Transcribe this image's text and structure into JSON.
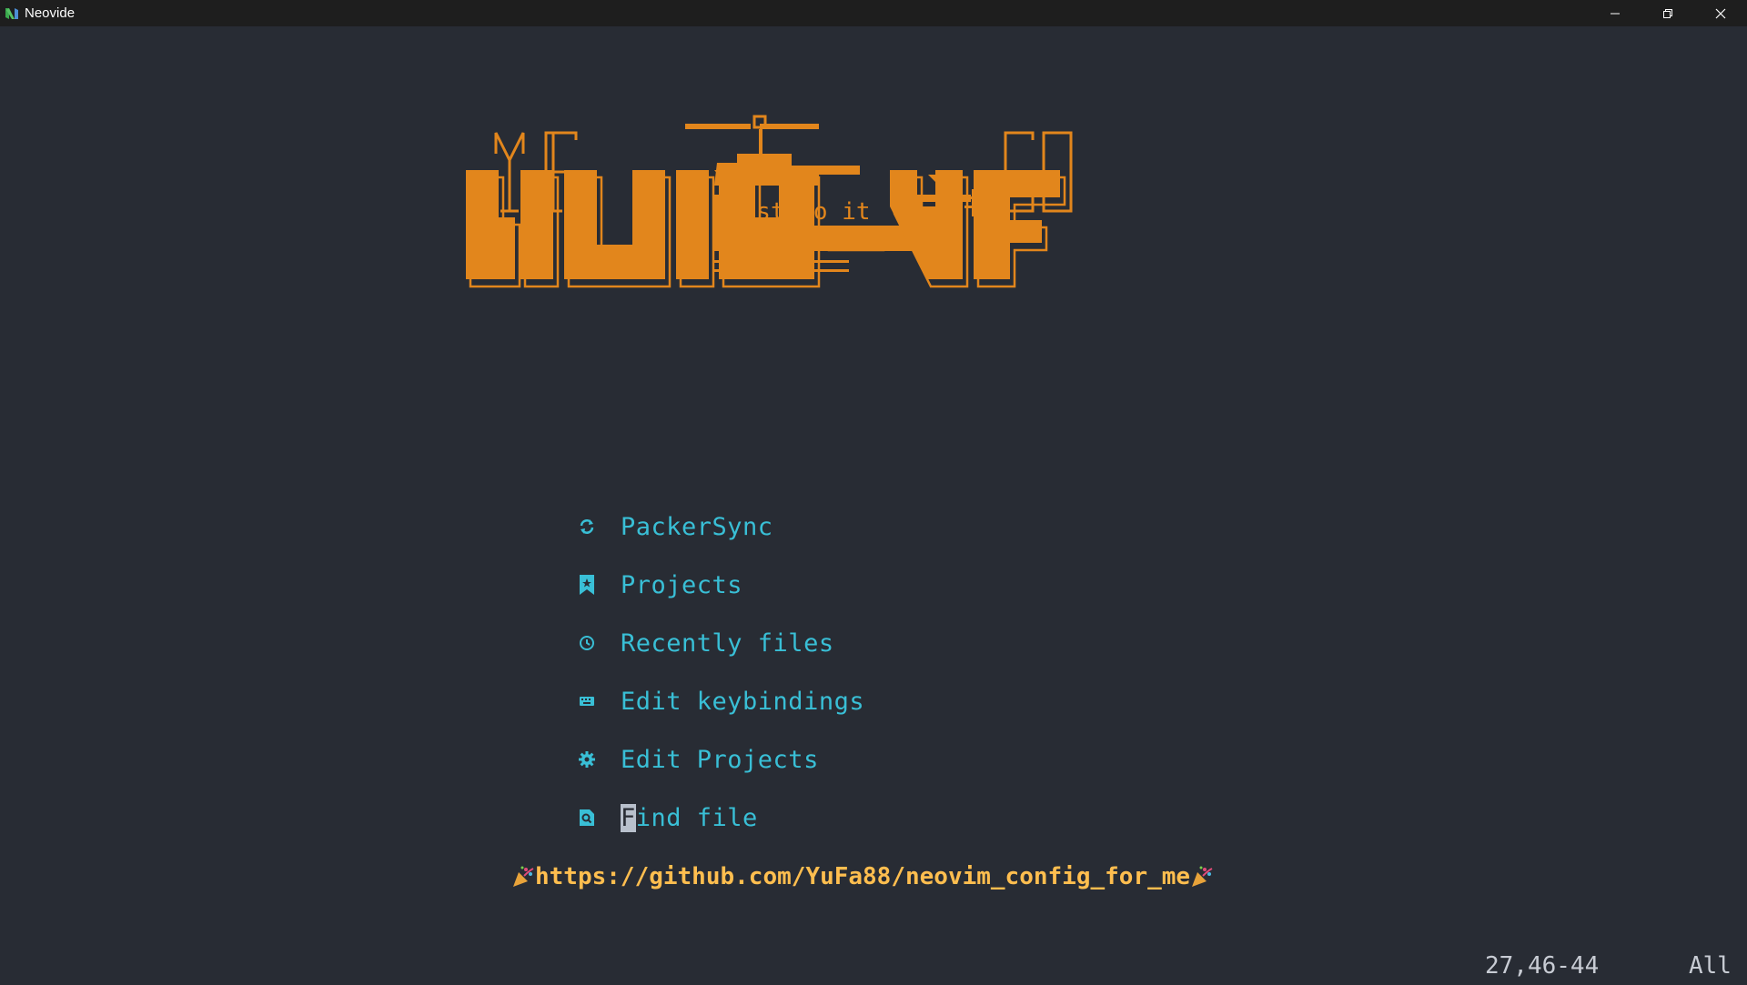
{
  "window": {
    "title": "Neovide",
    "controls": [
      "minimize",
      "restore",
      "close"
    ]
  },
  "colors": {
    "background": "#282c34",
    "banner_orange": "#e2861c",
    "menu_cyan": "#39bfd6",
    "footer_yellow": "#ffbe4f",
    "titlebar": "#1e1e1e"
  },
  "banner": {
    "left_tag": "YF",
    "right_tag": "GO",
    "helicopter_text": "just do it",
    "logo_text": "NVIM-YF"
  },
  "menu": {
    "items": [
      {
        "icon": "refresh-icon",
        "label": "PackerSync"
      },
      {
        "icon": "bookmark-icon",
        "label": "Projects"
      },
      {
        "icon": "history-icon",
        "label": "Recently files"
      },
      {
        "icon": "keyboard-icon",
        "label": "Edit keybindings"
      },
      {
        "icon": "gear-icon",
        "label": "Edit Projects"
      },
      {
        "icon": "file-search-icon",
        "label": "Find file"
      }
    ],
    "cursor_char": "F",
    "find_rest": "ind file"
  },
  "footer": {
    "url": "https://github.com/YuFa88/neovim_config_for_me"
  },
  "statusline": {
    "position": "27,46-44",
    "scroll": "All"
  }
}
